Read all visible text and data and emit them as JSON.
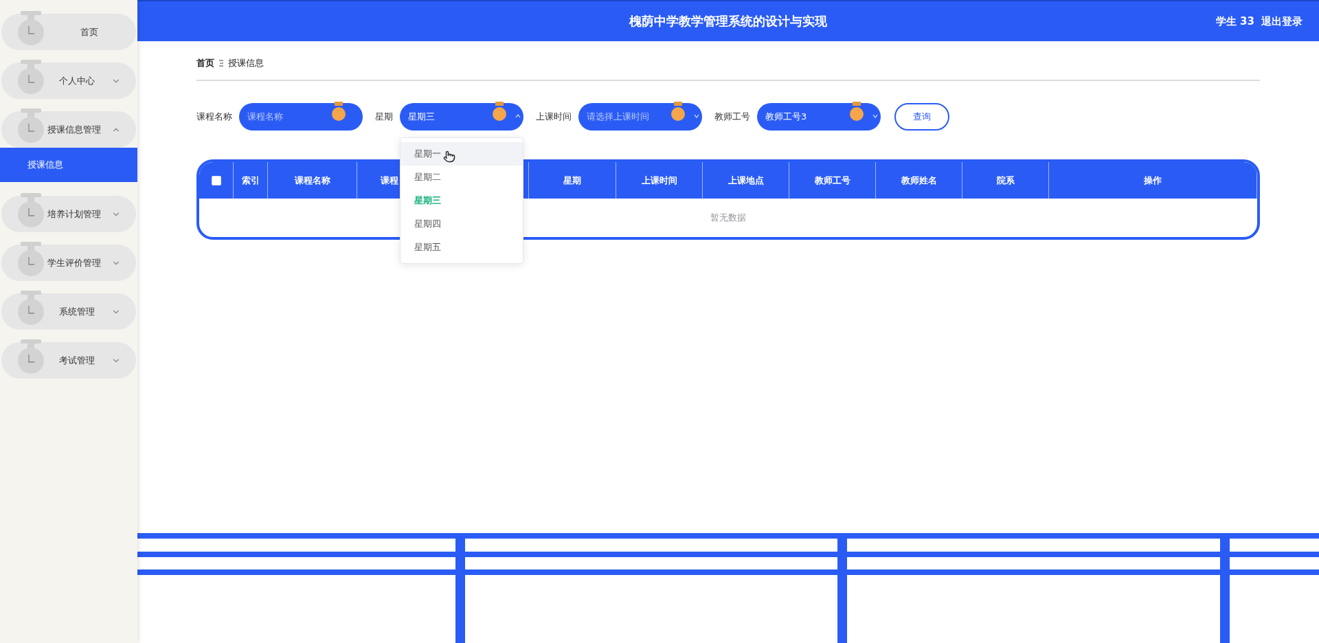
{
  "header": {
    "title": "槐荫中学教学管理系统的设计与实现",
    "user": "学生 33",
    "logout": "退出登录"
  },
  "sidebar": {
    "items": [
      {
        "label": "首页",
        "kind": "link"
      },
      {
        "label": "个人中心",
        "kind": "menu",
        "expanded": false
      },
      {
        "label": "授课信息管理",
        "kind": "menu",
        "expanded": true,
        "children": [
          {
            "label": "授课信息",
            "selected": true
          }
        ]
      },
      {
        "label": "培养计划管理",
        "kind": "menu",
        "expanded": false
      },
      {
        "label": "学生评价管理",
        "kind": "menu",
        "expanded": false
      },
      {
        "label": "系统管理",
        "kind": "menu",
        "expanded": false
      },
      {
        "label": "考试管理",
        "kind": "menu",
        "expanded": false
      }
    ]
  },
  "breadcrumb": [
    "首页",
    "授课信息"
  ],
  "filters": [
    {
      "label": "课程名称",
      "kind": "input",
      "placeholder": "课程名称"
    },
    {
      "label": "星期",
      "kind": "select",
      "value": "星期三",
      "open": true,
      "options": [
        {
          "label": "星期一",
          "selected": false,
          "hovered": true
        },
        {
          "label": "星期二",
          "selected": false,
          "hovered": false
        },
        {
          "label": "星期三",
          "selected": true,
          "hovered": false
        },
        {
          "label": "星期四",
          "selected": false,
          "hovered": false
        },
        {
          "label": "星期五",
          "selected": false,
          "hovered": false
        }
      ]
    },
    {
      "label": "上课时间",
      "kind": "select",
      "placeholder": "请选择上课时间",
      "open": false
    },
    {
      "label": "教师工号",
      "kind": "select",
      "value": "教师工号3",
      "open": false
    }
  ],
  "search_button": "查询",
  "table": {
    "select_all_checked": false,
    "columns": [
      "索引",
      "课程名称",
      "课程",
      "",
      "星期",
      "上课时间",
      "上课地点",
      "教师工号",
      "教师姓名",
      "院系",
      "操作"
    ],
    "empty_text": "暂无数据"
  }
}
